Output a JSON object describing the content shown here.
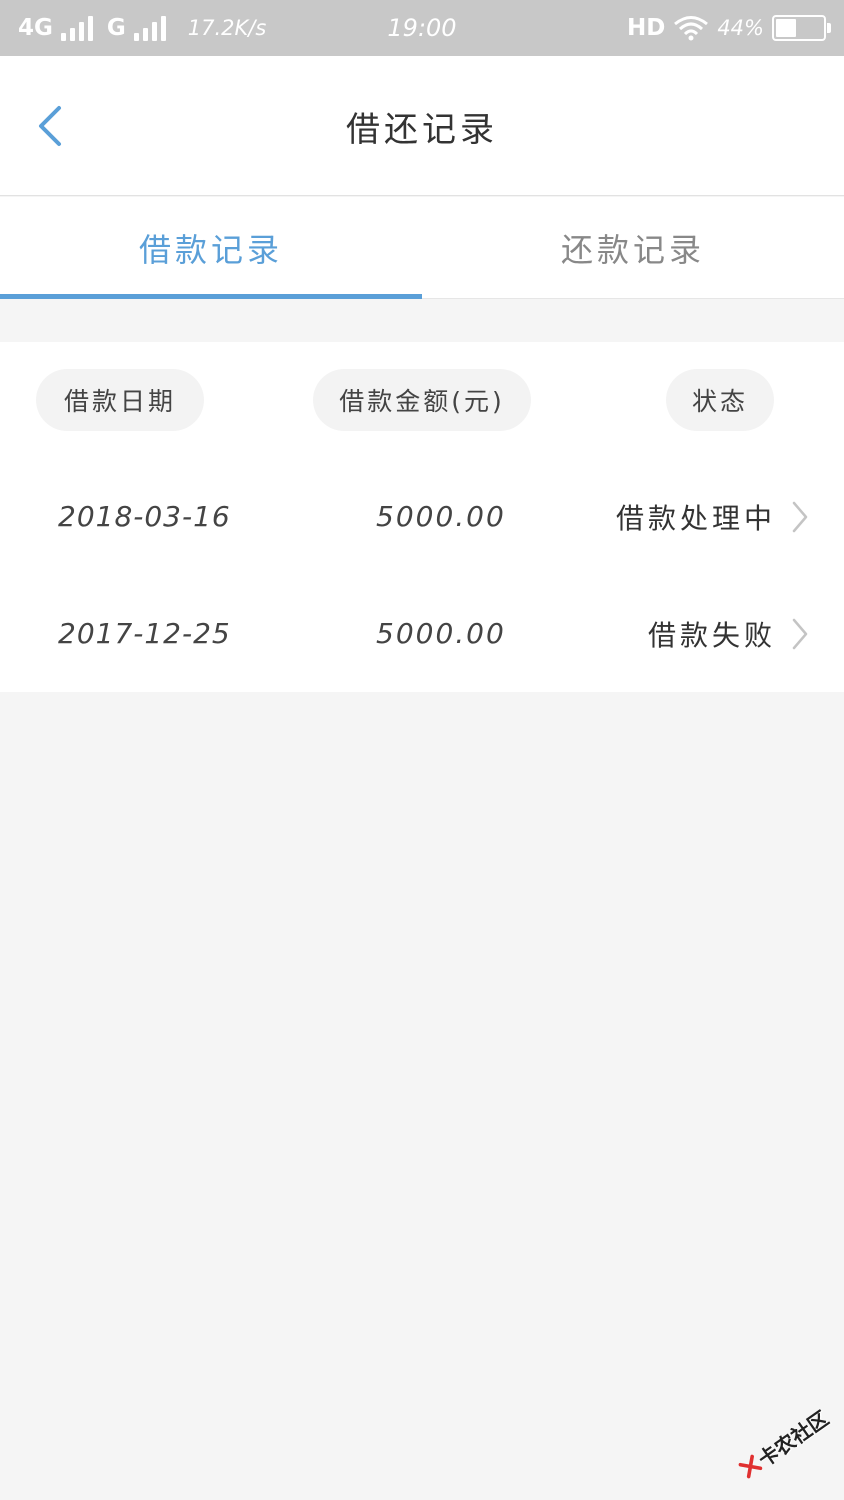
{
  "status_bar": {
    "network1": "4G",
    "network2": "G",
    "speed": "17.2K/s",
    "time": "19:00",
    "hd": "HD",
    "battery": "44%"
  },
  "header": {
    "title": "借还记录",
    "back_icon": "chevron-left-icon"
  },
  "tabs": [
    {
      "label": "借款记录",
      "active": true
    },
    {
      "label": "还款记录",
      "active": false
    }
  ],
  "columns": {
    "date": "借款日期",
    "amount": "借款金额(元)",
    "status": "状态"
  },
  "records": [
    {
      "date": "2018-03-16",
      "amount": "5000.00",
      "status": "借款处理中"
    },
    {
      "date": "2017-12-25",
      "amount": "5000.00",
      "status": "借款失败"
    }
  ],
  "watermark": {
    "text": "卡农社区"
  },
  "colors": {
    "accent": "#5a9fd8",
    "status_bar": "#c8c8c8",
    "background": "#f5f5f5"
  }
}
